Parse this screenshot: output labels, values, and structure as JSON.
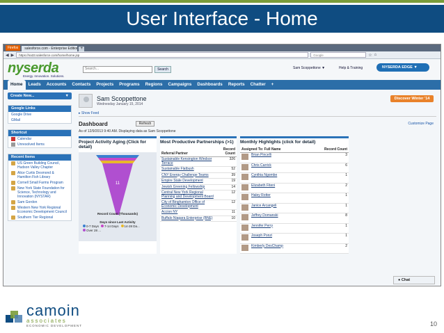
{
  "slide": {
    "title": "User Interface - Home",
    "page_number": "10",
    "colors": {
      "title_bg": "#0f4c81",
      "accent_green": "#7a9c3a"
    }
  },
  "footer": {
    "brand": "camoin",
    "sub1": "associates",
    "sub2": "ECONOMIC DEVELOPMENT"
  },
  "browser": {
    "firefox_label": "Firefox",
    "tab_label": "salesforce.com - Enterprise Edition",
    "new_tab": "+",
    "url": "https://na33.salesforce.com/home/home.jsp",
    "search_placeholder": "Google"
  },
  "header": {
    "logo": "nyserda",
    "tagline": "Energy. Innovation. Solutions.",
    "search_placeholder": "Search...",
    "search_button": "Search",
    "user_menu": "Sam Scoppettone ▼",
    "help": "Help & Training",
    "app_button": "NYSERDA EDGE ▼"
  },
  "nav": {
    "tabs": [
      "Home",
      "Leads",
      "Accounts",
      "Contacts",
      "Projects",
      "Programs",
      "Regions",
      "Campaigns",
      "Dashboards",
      "Reports",
      "Chatter",
      "+"
    ]
  },
  "sidebar": {
    "create_new": "Create New...",
    "google_links": {
      "header": "Google Links",
      "items": [
        "Google Drive",
        "GMail"
      ]
    },
    "shortcut": {
      "header": "Shortcut",
      "items": [
        "Calendar",
        "Unresolved Items"
      ]
    },
    "recent": {
      "header": "Recent Items",
      "items": [
        "US Green Building Council, Hudson Valley Chapter",
        "Alice Curtis Desmond & Hamilton Fish Library",
        "Cornell Small Farms Program",
        "New York State Foundation for Science, Technology and Innovation (NYSTAR)",
        "Sam Gordon",
        "Western New York Regional Economic Development Council",
        "Southern Tier Regional"
      ]
    }
  },
  "main": {
    "user_name": "Sam Scoppettone",
    "date": "Wednesday January 15, 2014",
    "show_feed": "Show Feed",
    "discover": "Discover Winter '14",
    "dashboard_title": "Dashboard",
    "refresh": "Refresh",
    "customize": "Customize Page",
    "as_of": "As of 12/9/2013 9:40 AM. Displaying data as Sam Scoppettone"
  },
  "aging": {
    "title": "Project Activity Aging (Click for detail)",
    "funnel_label": "11",
    "axis_label": "Record Count (Thousands)",
    "legend_title": "Days since Last Activity",
    "legend": [
      {
        "label": "0-7 Days",
        "color": "#3a7fd0"
      },
      {
        "label": "7-14 Days",
        "color": "#c74ac7"
      },
      {
        "label": "14-28 Da...",
        "color": "#e8b82a"
      },
      {
        "label": "Over 28 ...",
        "color": "#b04fd0"
      }
    ]
  },
  "partnerships": {
    "title": "Most Productive Partnerships (>1)",
    "col_partner": "Referral Partner",
    "col_count": "Record Count",
    "rows": [
      {
        "name": "Sustainable Kensington Windsor Terrace",
        "count": "326"
      },
      {
        "name": "Sustainable Flatbush",
        "count": "52"
      },
      {
        "name": "CNY Energy Challenge Teams",
        "count": "39"
      },
      {
        "name": "Empire State Development",
        "count": "19"
      },
      {
        "name": "Jewish Greening Fellowship",
        "count": "14"
      },
      {
        "name": "Central New York Regional Planning and Development Board",
        "count": "12"
      },
      {
        "name": "City of Binghamton Office of Economic Development",
        "count": "12"
      },
      {
        "name": "Accion NY",
        "count": "11"
      },
      {
        "name": "Buffalo Niagara Enterprise (BNE)",
        "count": "10"
      }
    ]
  },
  "highlights": {
    "title": "Monthly Highlights (click for detail)",
    "col_name": "Assigned To: Full Name",
    "col_count": "Record Count",
    "rows": [
      {
        "name": "Brian Pincelli",
        "count": "3"
      },
      {
        "name": "Chris Carrick",
        "count": "6"
      },
      {
        "name": "Cynthia Ngombe",
        "count": "1"
      },
      {
        "name": "Elizabeth Fiteni",
        "count": "2"
      },
      {
        "name": "Haley Rotter",
        "count": "1"
      },
      {
        "name": "Janice Arcangeli",
        "count": "1"
      },
      {
        "name": "Jeffrey Domanski",
        "count": "8"
      },
      {
        "name": "Jennifer Perry",
        "count": "1"
      },
      {
        "name": "Joseph Ponzi",
        "count": "1"
      },
      {
        "name": "Kimberly DesChamp",
        "count": "2"
      }
    ]
  },
  "chat": "Chat"
}
